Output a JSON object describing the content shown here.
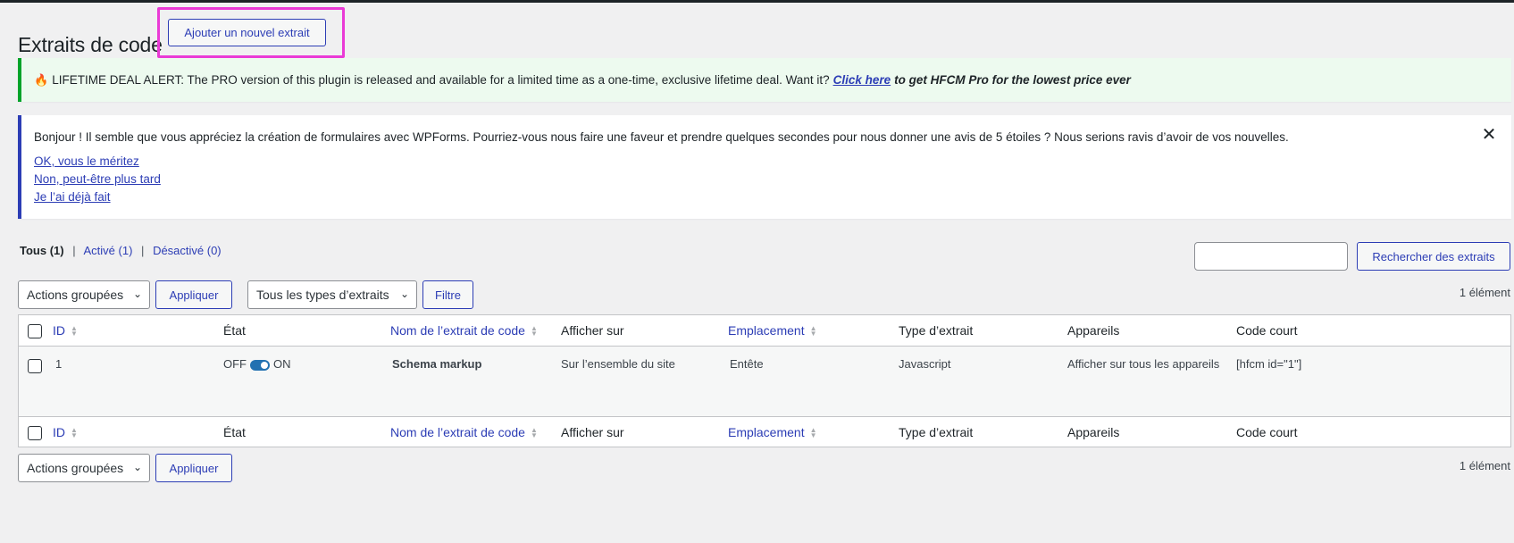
{
  "page": {
    "title": "Extraits de code",
    "add_button": "Ajouter un nouvel extrait"
  },
  "deal_notice": {
    "text": "LIFETIME DEAL ALERT: The PRO version of this plugin is released and available for a limited time as a one-time, exclusive lifetime deal. Want it?",
    "link": "Click here",
    "tail": "to get HFCM Pro for the lowest price ever"
  },
  "review_notice": {
    "message": "Bonjour ! Il semble que vous appréciez la création de formulaires avec WPForms. Pourriez-vous nous faire une faveur et prendre quelques secondes pour nous donner une avis de 5 étoiles ? Nous serions ravis d’avoir de vos nouvelles.",
    "links": [
      "OK, vous le méritez",
      "Non, peut-être plus tard",
      "Je l’ai déjà fait"
    ],
    "dismiss": "✕"
  },
  "views": {
    "all": "Tous (1)",
    "active": "Activé (1)",
    "inactive": "Désactivé (0)",
    "separator": "|"
  },
  "search": {
    "value": "",
    "button": "Rechercher des extraits"
  },
  "bulk": {
    "selected": "Actions groupées",
    "apply": "Appliquer"
  },
  "type_filter": {
    "selected": "Tous les types d’extraits",
    "button": "Filtre"
  },
  "count": "1 élément",
  "columns": {
    "id": "ID",
    "state": "État",
    "name": "Nom de l’extrait de code",
    "display_on": "Afficher sur",
    "location": "Emplacement",
    "type": "Type d’extrait",
    "devices": "Appareils",
    "shortcode": "Code court"
  },
  "rows": [
    {
      "id": "1",
      "state_off": "OFF",
      "state_on": "ON",
      "name": "Schema markup",
      "display_on": "Sur l’ensemble du site",
      "location": "Entête",
      "type": "Javascript",
      "devices": "Afficher sur tous les appareils",
      "shortcode": "[hfcm id=\"1\"]"
    }
  ]
}
